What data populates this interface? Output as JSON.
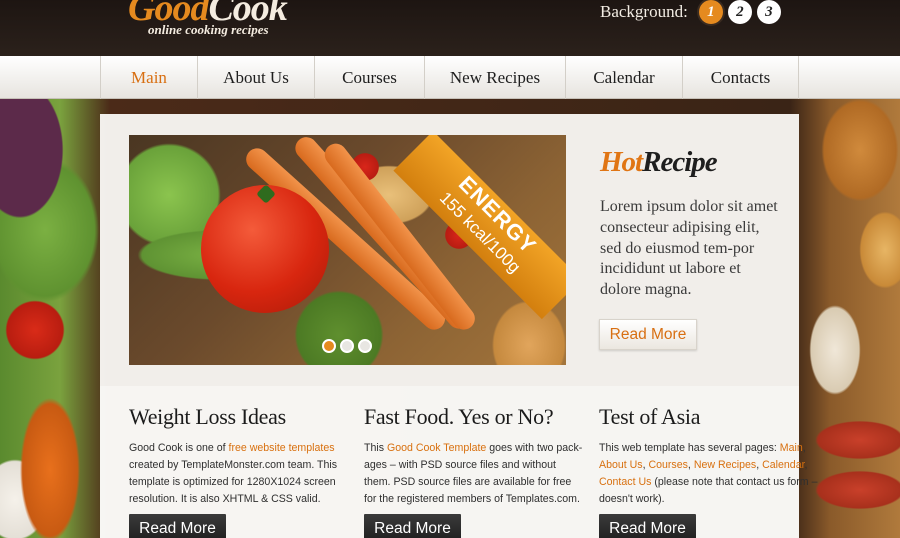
{
  "header": {
    "logo_good": "Good",
    "logo_cook": "Cook",
    "logo_tagline": "online cooking recipes",
    "background_label": "Background:",
    "background_options": [
      "1",
      "2",
      "3"
    ],
    "background_selected": "1"
  },
  "nav": {
    "items": [
      "Main",
      "About Us",
      "Courses",
      "New Recipes",
      "Calendar",
      "Contacts"
    ],
    "active": "Main"
  },
  "slider": {
    "ribbon_title": "ENERGY",
    "ribbon_value": "155 kcal/100g",
    "active_slide": 1,
    "slide_count": 3
  },
  "hot_recipe": {
    "title_hot": "Hot",
    "title_recipe": "Recipe",
    "text": "Lorem ipsum dolor sit amet consecteur adipising elit, sed do eiusmod tem-por incididunt ut labore et dolore magna.",
    "button": "Read More"
  },
  "columns": [
    {
      "title": "Weight Loss Ideas",
      "p1": "Good Cook is one of ",
      "link1": "free website templates",
      "p2": " created by TemplateMonster.com team. This template is optimized for 1280X1024 screen resolution. It is also XHTML & CSS valid.",
      "button": "Read More"
    },
    {
      "title": "Fast Food. Yes or No?",
      "p1": "This ",
      "link1": "Good Cook Template",
      "p2": " goes with two pack-ages – with PSD source files and without them. PSD source files are available for free for the registered members of Templates.com.",
      "button": "Read More"
    },
    {
      "title": "Test of Asia",
      "p1": "This web template has several pages: ",
      "links": [
        "Main",
        "About Us",
        "Courses",
        "New Recipes",
        "Calendar",
        "Contact Us"
      ],
      "p2": " (please note that contact us form – doesn't work).",
      "button": "Read More"
    }
  ],
  "colors": {
    "accent": "#e58a1f",
    "link": "#d8700f",
    "dark_button": "#2a2a2a"
  }
}
